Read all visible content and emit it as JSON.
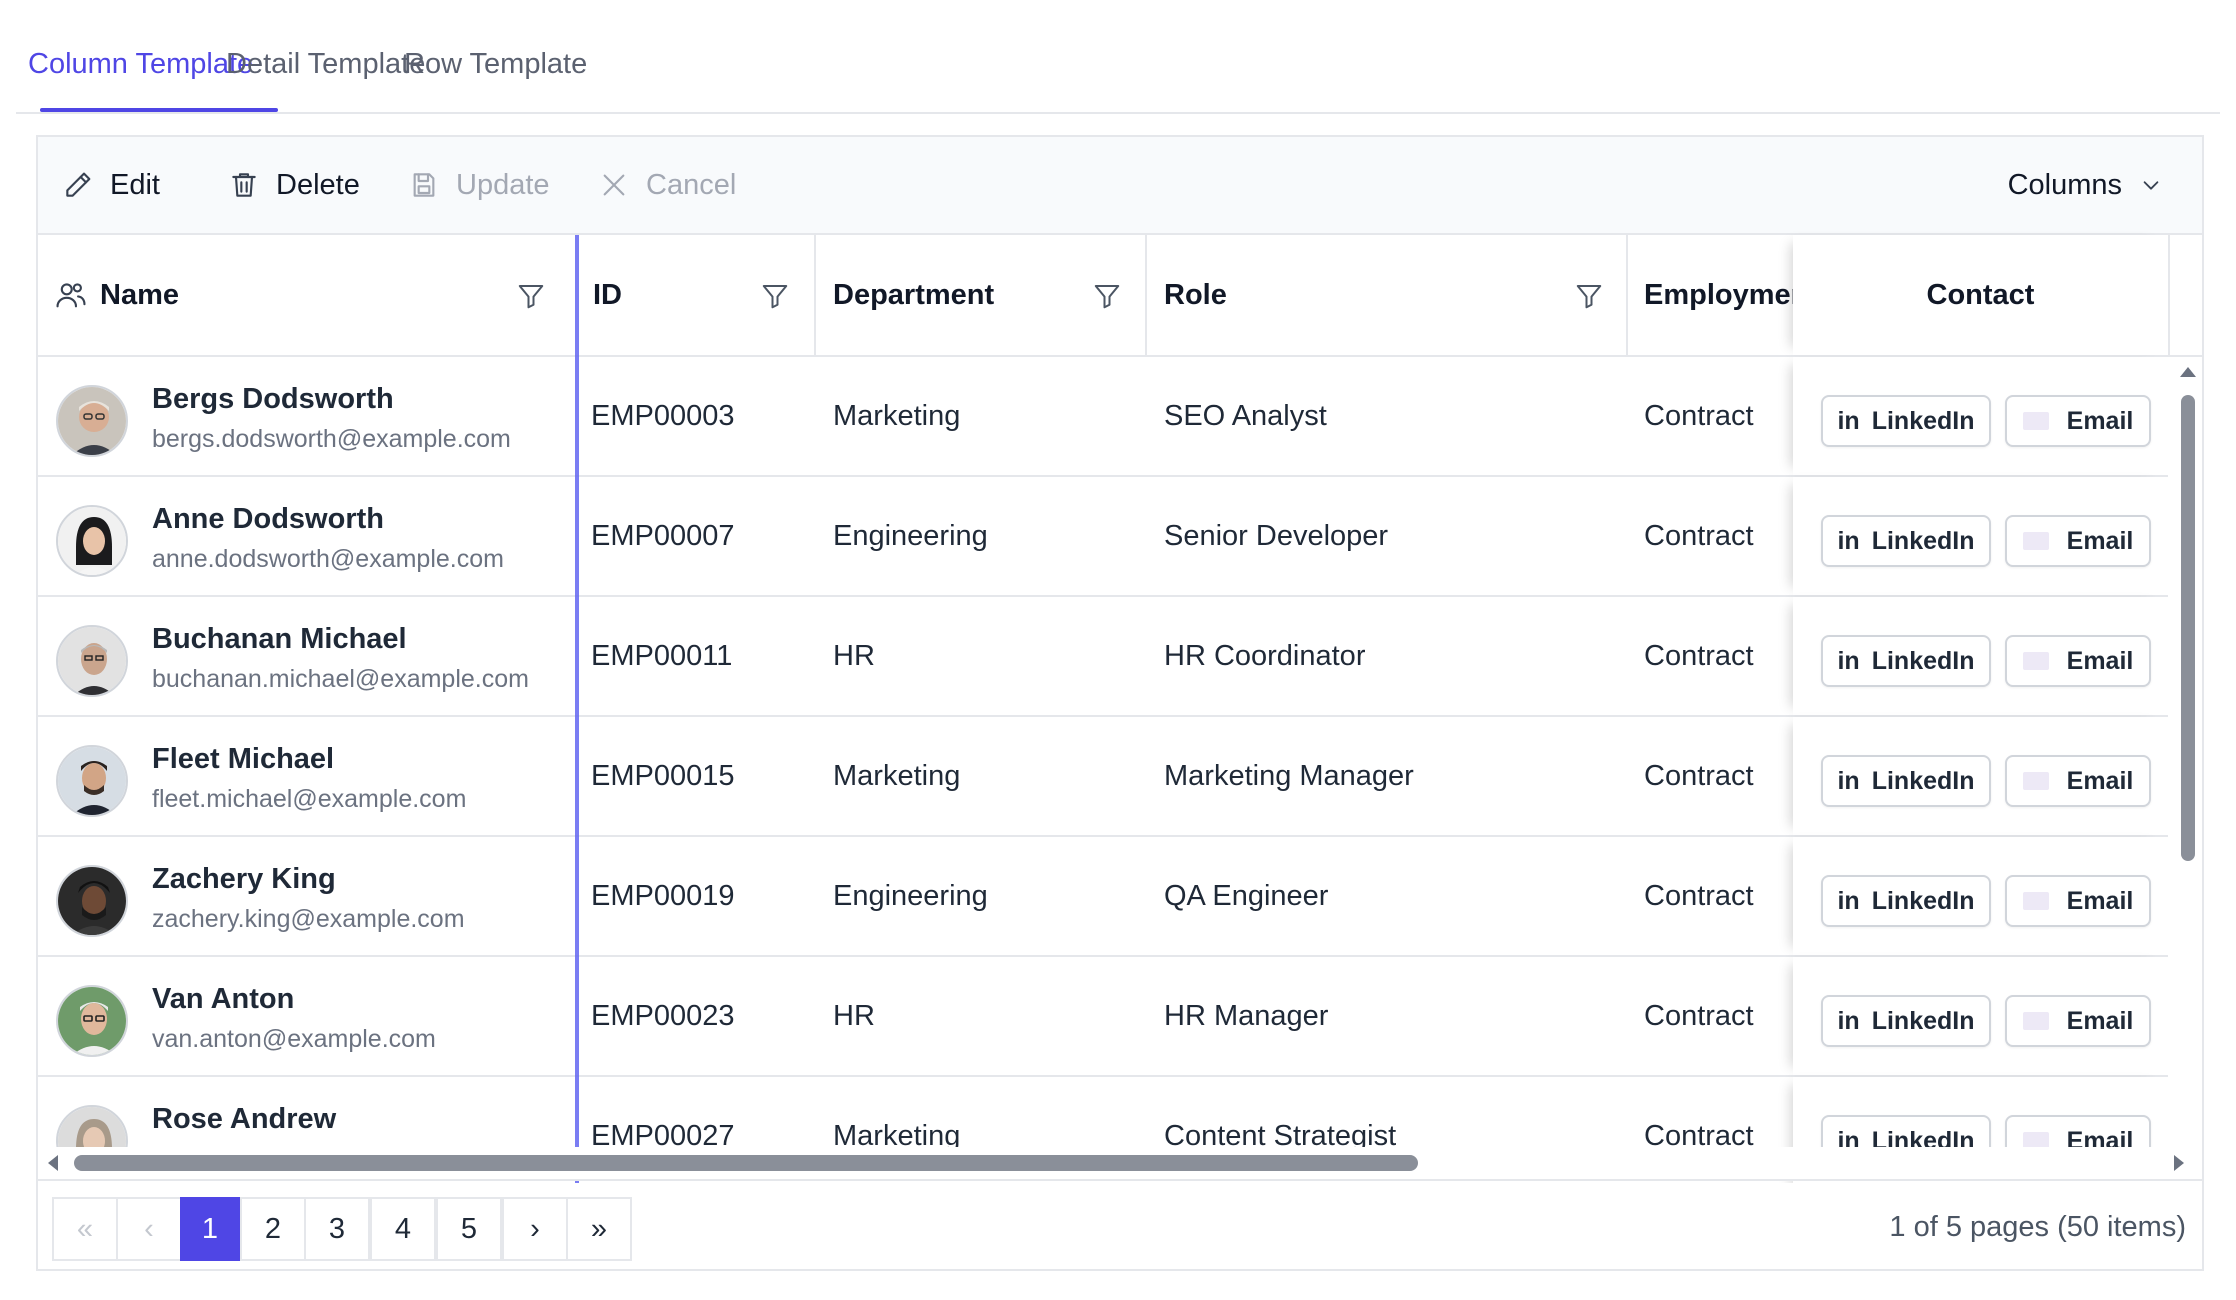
{
  "tabs": [
    {
      "label": "Column Template",
      "active": true
    },
    {
      "label": "Detail Template",
      "active": false
    },
    {
      "label": "Row Template",
      "active": false
    }
  ],
  "toolbar": {
    "edit": "Edit",
    "delete": "Delete",
    "update": "Update",
    "cancel": "Cancel",
    "columns": "Columns"
  },
  "columns": {
    "name": "Name",
    "id": "ID",
    "department": "Department",
    "role": "Role",
    "employment": "Employment Type",
    "contact": "Contact"
  },
  "rows": [
    {
      "name": "Bergs Dodsworth",
      "email": "bergs.dodsworth@example.com",
      "id": "EMP00003",
      "department": "Marketing",
      "role": "SEO Analyst",
      "employment": "Contract",
      "linkedin": "LinkedIn",
      "email_btn": "Email"
    },
    {
      "name": "Anne Dodsworth",
      "email": "anne.dodsworth@example.com",
      "id": "EMP00007",
      "department": "Engineering",
      "role": "Senior Developer",
      "employment": "Contract",
      "linkedin": "LinkedIn",
      "email_btn": "Email"
    },
    {
      "name": "Buchanan Michael",
      "email": "buchanan.michael@example.com",
      "id": "EMP00011",
      "department": "HR",
      "role": "HR Coordinator",
      "employment": "Contract",
      "linkedin": "LinkedIn",
      "email_btn": "Email"
    },
    {
      "name": "Fleet Michael",
      "email": "fleet.michael@example.com",
      "id": "EMP00015",
      "department": "Marketing",
      "role": "Marketing Manager",
      "employment": "Contract",
      "linkedin": "LinkedIn",
      "email_btn": "Email"
    },
    {
      "name": "Zachery King",
      "email": "zachery.king@example.com",
      "id": "EMP00019",
      "department": "Engineering",
      "role": "QA Engineer",
      "employment": "Contract",
      "linkedin": "LinkedIn",
      "email_btn": "Email"
    },
    {
      "name": "Van Anton",
      "email": "van.anton@example.com",
      "id": "EMP00023",
      "department": "HR",
      "role": "HR Manager",
      "employment": "Contract",
      "linkedin": "LinkedIn",
      "email_btn": "Email"
    },
    {
      "name": "Rose Andrew",
      "email": "",
      "id": "EMP00027",
      "department": "Marketing",
      "role": "Content Strategist",
      "employment": "Contract",
      "linkedin": "LinkedIn",
      "email_btn": "Email"
    }
  ],
  "pager": {
    "first": "«",
    "prev": "‹",
    "pages": [
      "1",
      "2",
      "3",
      "4",
      "5"
    ],
    "current": "1",
    "next": "›",
    "last": "»",
    "info": "1 of 5 pages (50 items)"
  },
  "colors": {
    "accent": "#4f46e5",
    "frozen_line": "#6366f1"
  },
  "icons": {
    "edit": "pencil-icon",
    "delete": "trash-icon",
    "update": "save-icon",
    "cancel": "close-icon",
    "columns": "chevron-down-icon",
    "name_header": "users-icon",
    "filter": "filter-icon"
  }
}
